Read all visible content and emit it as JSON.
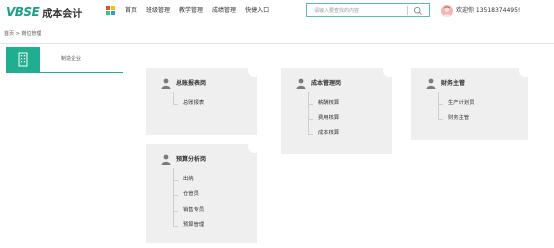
{
  "header": {
    "logo_mark": "VBSE",
    "logo_text": "成本会计",
    "apps_colors": [
      "#e74c3c",
      "#f1c40f",
      "#2ecc71",
      "#3498db"
    ],
    "nav": [
      "首页",
      "班级管理",
      "教学管理",
      "成绩管理",
      "快捷入口"
    ],
    "search_placeholder": "请输入要查找的内容",
    "welcome": "欢迎你 13518374495!"
  },
  "breadcrumb": "首页 > 岗位管理",
  "sidebar": {
    "tab_label": "制造企业"
  },
  "accent_color": "#1fae8f",
  "cards": [
    {
      "title": "总账报表岗",
      "items": [
        "总账报表"
      ]
    },
    {
      "title": "成本管理岗",
      "items": [
        "薪酬核算",
        "费用核算",
        "成本核算"
      ]
    },
    {
      "title": "财务主管",
      "items": [
        "生产计划员",
        "财务主管"
      ]
    },
    {
      "title": "预算分析岗",
      "items": [
        "出纳",
        "仓管员",
        "销售专员",
        "预算管理"
      ]
    }
  ]
}
